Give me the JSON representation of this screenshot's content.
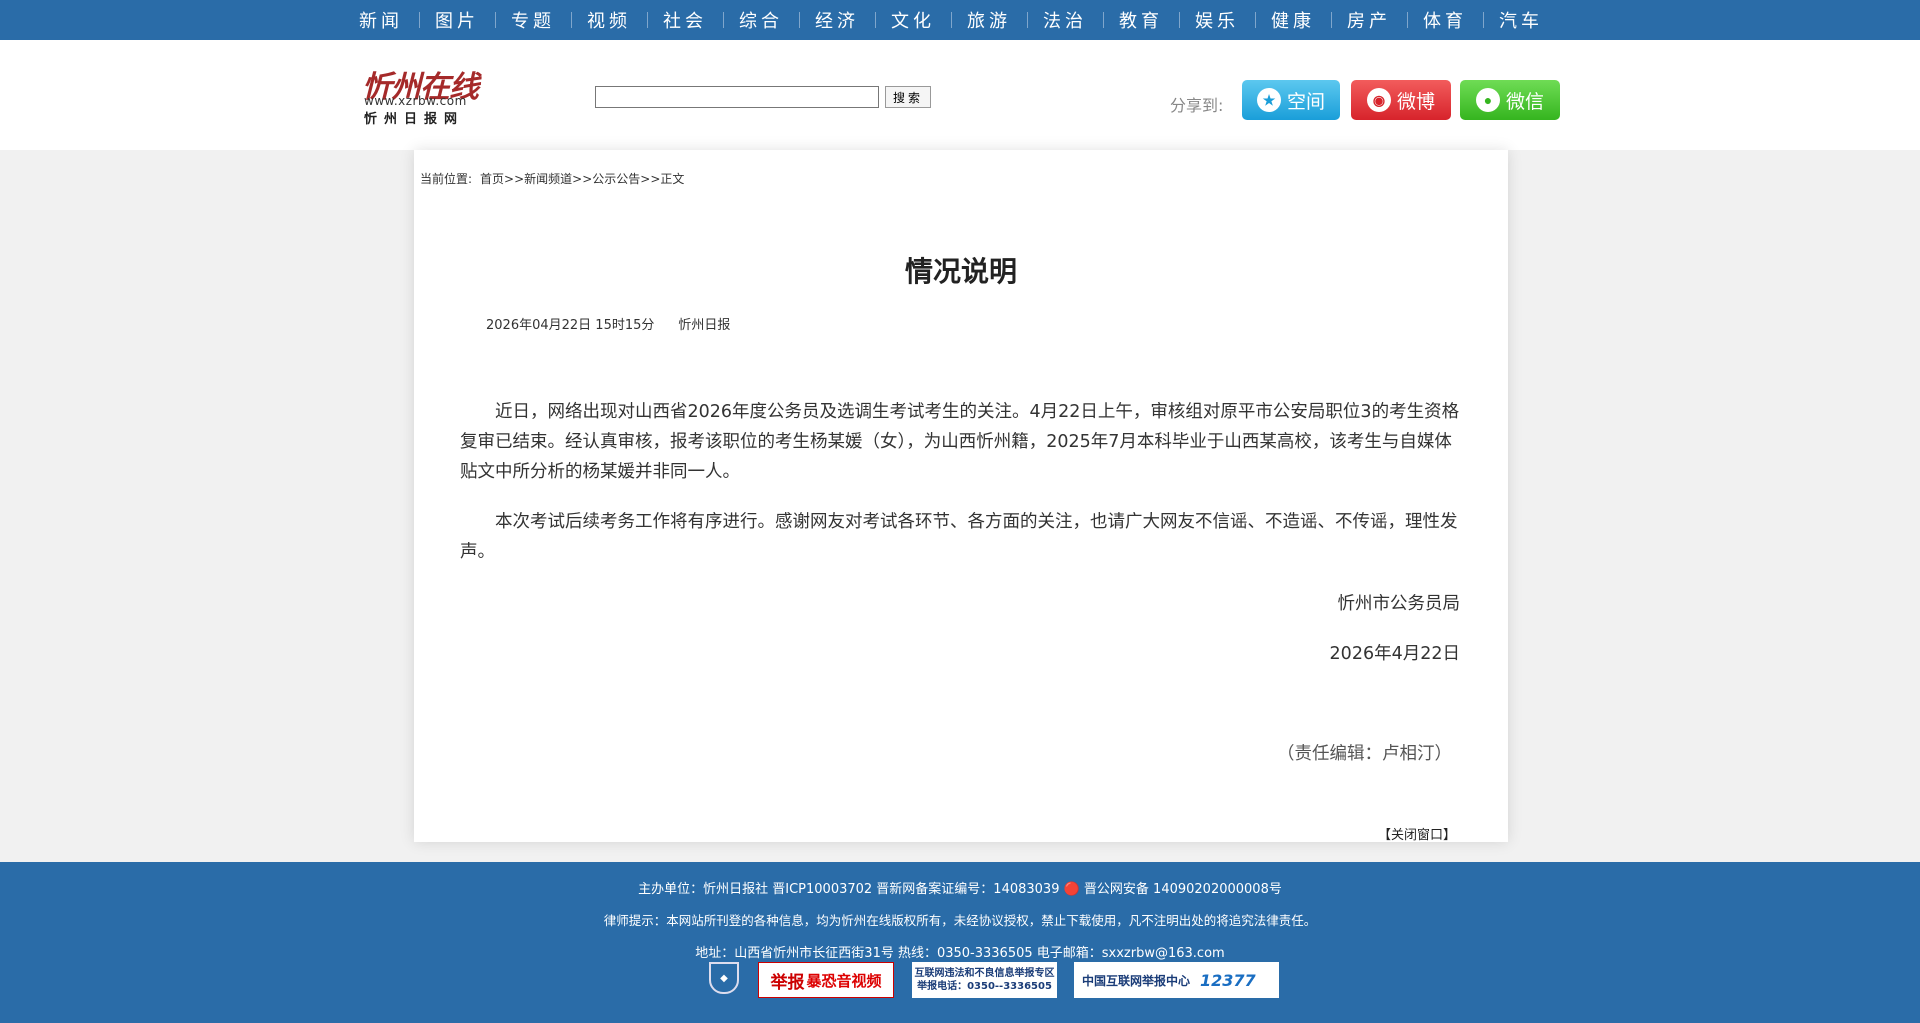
{
  "nav": [
    "新闻",
    "图片",
    "专题",
    "视频",
    "社会",
    "综合",
    "经济",
    "文化",
    "旅游",
    "法治",
    "教育",
    "娱乐",
    "健康",
    "房产",
    "体育",
    "汽车"
  ],
  "logo": {
    "mark": "忻州在线",
    "url": "www.xzrbw.com",
    "name": "忻州日报网"
  },
  "search": {
    "button": "搜索",
    "value": ""
  },
  "share": {
    "label": "分享到:",
    "qzone": "空间",
    "weibo": "微博",
    "wechat": "微信"
  },
  "breadcrumb": {
    "label": "当前位置:",
    "path": "首页>>新闻频道>>公示公告>>正文"
  },
  "article": {
    "title": "情况说明",
    "date": "2026年04月22日 15时15分",
    "source": "忻州日报",
    "paragraphs": [
      "近日，网络出现对山西省2026年度公务员及选调生考试考生的关注。4月22日上午，审核组对原平市公安局职位3的考生资格复审已结束。经认真审核，报考该职位的考生杨某媛（女），为山西忻州籍，2025年7月本科毕业于山西某高校，该考生与自媒体贴文中所分析的杨某媛并非同一人。",
      "本次考试后续考务工作将有序进行。感谢网友对考试各环节、各方面的关注，也请广大网友不信谣、不造谣、不传谣，理性发声。"
    ],
    "signature": "忻州市公务员局",
    "sign_date": "2026年4月22日",
    "editor": "（责任编辑：卢相汀）",
    "close": "【关闭窗口】"
  },
  "footer": {
    "line1": "主办单位：忻州日报社 晋ICP10003702 晋新网备案证编号：14083039 🔴 晋公网安备 14090202000008号",
    "line2": "律师提示：本网站所刊登的各种信息，均为忻州在线版权所有，未经协议授权，禁止下载使用，凡不注明出处的将追究法律责任。",
    "line3": "地址：山西省忻州市长征西街31号 热线：0350-3336505 电子邮箱：sxxzrbw@163.com",
    "badge_report": "举报",
    "badge_report_sub": "暴恐音视频",
    "badge_law_1": "互联网违法和不良信息举报专区",
    "badge_law_2": "举报电话：0350--3336505",
    "badge_cac": "中国互联网举报中心",
    "badge_cac_num": "12377"
  }
}
